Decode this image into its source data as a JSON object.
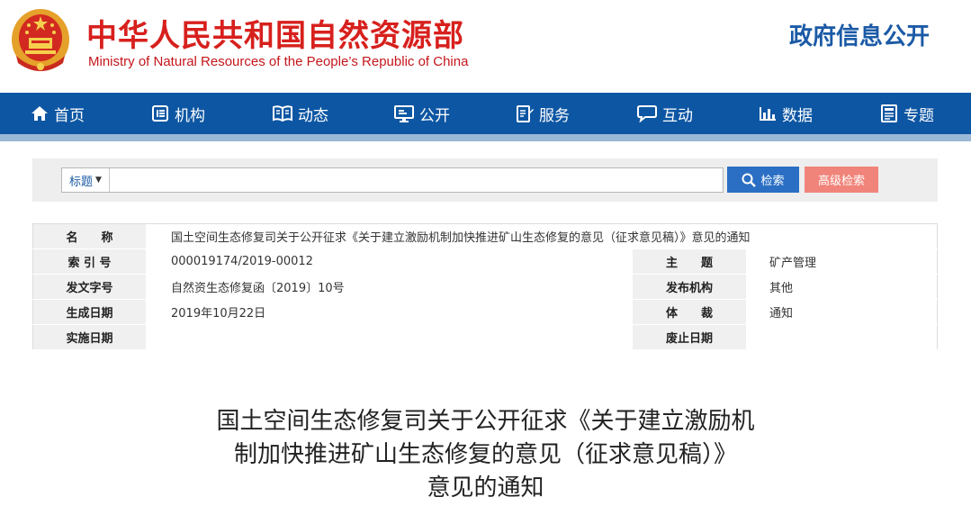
{
  "header": {
    "title_cn": "中华人民共和国自然资源部",
    "title_en": "Ministry of Natural Resources of the People’s Republic of China",
    "section_title": "政府信息公开"
  },
  "nav": {
    "items": [
      {
        "label": "首页",
        "icon": "home-icon"
      },
      {
        "label": "机构",
        "icon": "org-icon"
      },
      {
        "label": "动态",
        "icon": "book-icon"
      },
      {
        "label": "公开",
        "icon": "monitor-icon"
      },
      {
        "label": "服务",
        "icon": "edit-icon"
      },
      {
        "label": "互动",
        "icon": "chat-icon"
      },
      {
        "label": "数据",
        "icon": "bar-chart-icon"
      },
      {
        "label": "专题",
        "icon": "document-icon"
      }
    ]
  },
  "search": {
    "field_label": "标题",
    "placeholder": "",
    "value": "",
    "search_button": "检索",
    "advanced_button": "高级检索"
  },
  "info": {
    "name_label": "名　　称",
    "name_value": "国土空间生态修复司关于公开征求《关于建立激励机制加快推进矿山生态修复的意见（征求意见稿）》意见的通知",
    "index_label": "索 引 号",
    "index_value": "000019174/2019-00012",
    "theme_label": "主　　题",
    "theme_value": "矿产管理",
    "doc_no_label": "发文字号",
    "doc_no_value": "自然资生态修复函〔2019〕10号",
    "issuer_label": "发布机构",
    "issuer_value": "其他",
    "created_label": "生成日期",
    "created_value": "2019年10月22日",
    "genre_label": "体　　裁",
    "genre_value": "通知",
    "effective_label": "实施日期",
    "effective_value": "",
    "repeal_label": "废止日期",
    "repeal_value": ""
  },
  "article": {
    "title_line1": "国土空间生态修复司关于公开征求《关于建立激励机",
    "title_line2": "制加快推进矿山生态修复的意见（征求意见稿）》",
    "title_line3": "意见的通知"
  },
  "colors": {
    "brand_red": "#d7201d",
    "nav_blue": "#0d56a3",
    "section_blue": "#1b5aa6",
    "search_blue": "#2b6fc4",
    "advanced_salmon": "#f1847a"
  }
}
